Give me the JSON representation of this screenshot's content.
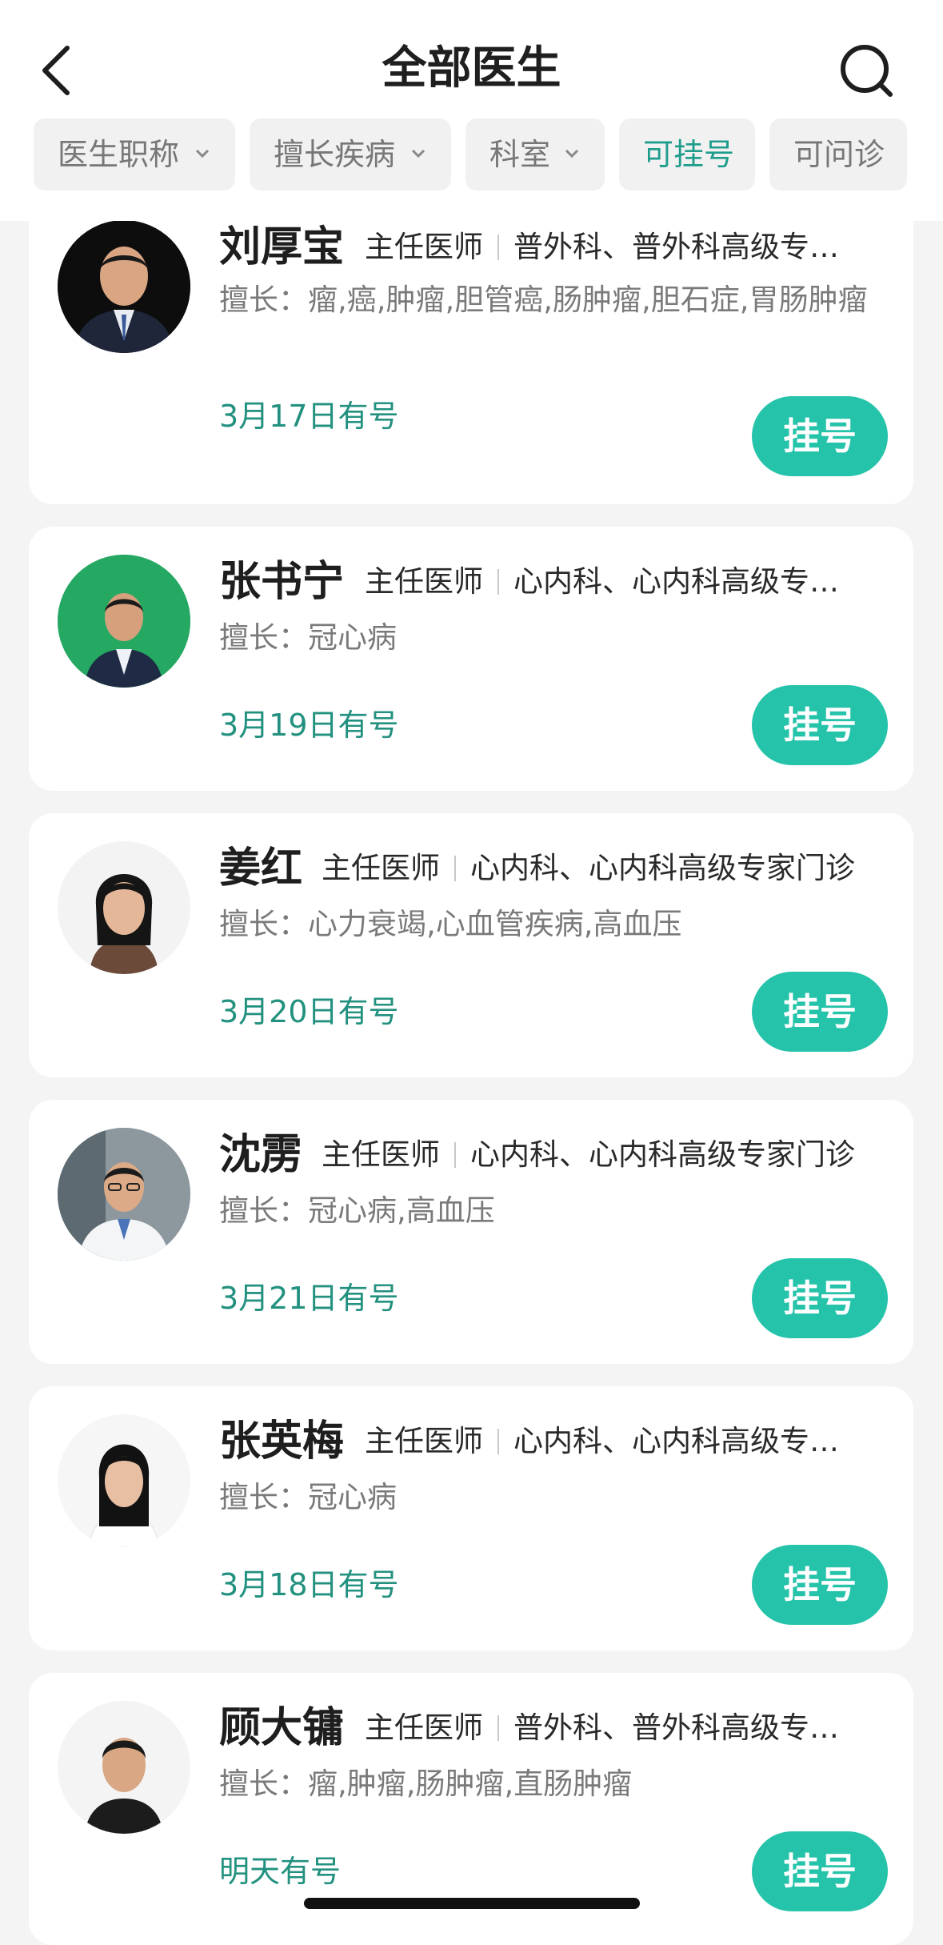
{
  "header": {
    "title": "全部医生"
  },
  "filters": [
    {
      "label": "医生职称",
      "has_dropdown": true,
      "active": false
    },
    {
      "label": "擅长疾病",
      "has_dropdown": true,
      "active": false
    },
    {
      "label": "科室",
      "has_dropdown": true,
      "active": false
    },
    {
      "label": "可挂号",
      "has_dropdown": false,
      "active": true
    },
    {
      "label": "可问诊",
      "has_dropdown": false,
      "active": false
    }
  ],
  "doctors": [
    {
      "name": "刘厚宝",
      "title": "主任医师",
      "dept": "普外科、普外科高级专家门诊",
      "skill_prefix": "擅长：",
      "skill": "瘤,癌,肿瘤,胆管癌,肠肿瘤,胆石症,胃肠肿瘤",
      "availability": "3月17日有号",
      "book_label": "挂号"
    },
    {
      "name": "张书宁",
      "title": "主任医师",
      "dept": "心内科、心内科高级专家门诊",
      "skill_prefix": "擅长：",
      "skill": "冠心病",
      "availability": "3月19日有号",
      "book_label": "挂号"
    },
    {
      "name": "姜红",
      "title": "主任医师",
      "dept": "心内科、心内科高级专家门诊",
      "skill_prefix": "擅长：",
      "skill": "心力衰竭,心血管疾病,高血压",
      "availability": "3月20日有号",
      "book_label": "挂号"
    },
    {
      "name": "沈雳",
      "title": "主任医师",
      "dept": "心内科、心内科高级专家门诊",
      "skill_prefix": "擅长：",
      "skill": "冠心病,高血压",
      "availability": "3月21日有号",
      "book_label": "挂号"
    },
    {
      "name": "张英梅",
      "title": "主任医师",
      "dept": "心内科、心内科高级专家门诊",
      "skill_prefix": "擅长：",
      "skill": "冠心病",
      "availability": "3月18日有号",
      "book_label": "挂号"
    },
    {
      "name": "顾大镛",
      "title": "主任医师",
      "dept": "普外科、普外科高级专家门诊",
      "skill_prefix": "擅长：",
      "skill": "瘤,肿瘤,肠肿瘤,直肠肿瘤",
      "availability": "明天有号",
      "book_label": "挂号"
    }
  ],
  "colors": {
    "accent": "#25c3aa",
    "accent_text": "#23917f",
    "background": "#f4f4f5"
  }
}
